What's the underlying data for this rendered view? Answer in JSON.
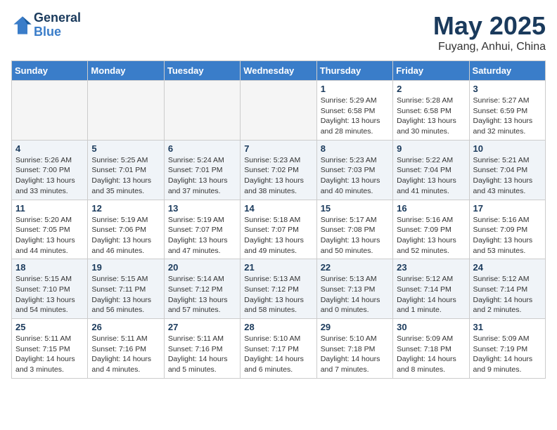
{
  "header": {
    "logo_line1": "General",
    "logo_line2": "Blue",
    "month": "May 2025",
    "location": "Fuyang, Anhui, China"
  },
  "weekdays": [
    "Sunday",
    "Monday",
    "Tuesday",
    "Wednesday",
    "Thursday",
    "Friday",
    "Saturday"
  ],
  "weeks": [
    [
      {
        "day": "",
        "info": ""
      },
      {
        "day": "",
        "info": ""
      },
      {
        "day": "",
        "info": ""
      },
      {
        "day": "",
        "info": ""
      },
      {
        "day": "1",
        "info": "Sunrise: 5:29 AM\nSunset: 6:58 PM\nDaylight: 13 hours\nand 28 minutes."
      },
      {
        "day": "2",
        "info": "Sunrise: 5:28 AM\nSunset: 6:58 PM\nDaylight: 13 hours\nand 30 minutes."
      },
      {
        "day": "3",
        "info": "Sunrise: 5:27 AM\nSunset: 6:59 PM\nDaylight: 13 hours\nand 32 minutes."
      }
    ],
    [
      {
        "day": "4",
        "info": "Sunrise: 5:26 AM\nSunset: 7:00 PM\nDaylight: 13 hours\nand 33 minutes."
      },
      {
        "day": "5",
        "info": "Sunrise: 5:25 AM\nSunset: 7:01 PM\nDaylight: 13 hours\nand 35 minutes."
      },
      {
        "day": "6",
        "info": "Sunrise: 5:24 AM\nSunset: 7:01 PM\nDaylight: 13 hours\nand 37 minutes."
      },
      {
        "day": "7",
        "info": "Sunrise: 5:23 AM\nSunset: 7:02 PM\nDaylight: 13 hours\nand 38 minutes."
      },
      {
        "day": "8",
        "info": "Sunrise: 5:23 AM\nSunset: 7:03 PM\nDaylight: 13 hours\nand 40 minutes."
      },
      {
        "day": "9",
        "info": "Sunrise: 5:22 AM\nSunset: 7:04 PM\nDaylight: 13 hours\nand 41 minutes."
      },
      {
        "day": "10",
        "info": "Sunrise: 5:21 AM\nSunset: 7:04 PM\nDaylight: 13 hours\nand 43 minutes."
      }
    ],
    [
      {
        "day": "11",
        "info": "Sunrise: 5:20 AM\nSunset: 7:05 PM\nDaylight: 13 hours\nand 44 minutes."
      },
      {
        "day": "12",
        "info": "Sunrise: 5:19 AM\nSunset: 7:06 PM\nDaylight: 13 hours\nand 46 minutes."
      },
      {
        "day": "13",
        "info": "Sunrise: 5:19 AM\nSunset: 7:07 PM\nDaylight: 13 hours\nand 47 minutes."
      },
      {
        "day": "14",
        "info": "Sunrise: 5:18 AM\nSunset: 7:07 PM\nDaylight: 13 hours\nand 49 minutes."
      },
      {
        "day": "15",
        "info": "Sunrise: 5:17 AM\nSunset: 7:08 PM\nDaylight: 13 hours\nand 50 minutes."
      },
      {
        "day": "16",
        "info": "Sunrise: 5:16 AM\nSunset: 7:09 PM\nDaylight: 13 hours\nand 52 minutes."
      },
      {
        "day": "17",
        "info": "Sunrise: 5:16 AM\nSunset: 7:09 PM\nDaylight: 13 hours\nand 53 minutes."
      }
    ],
    [
      {
        "day": "18",
        "info": "Sunrise: 5:15 AM\nSunset: 7:10 PM\nDaylight: 13 hours\nand 54 minutes."
      },
      {
        "day": "19",
        "info": "Sunrise: 5:15 AM\nSunset: 7:11 PM\nDaylight: 13 hours\nand 56 minutes."
      },
      {
        "day": "20",
        "info": "Sunrise: 5:14 AM\nSunset: 7:12 PM\nDaylight: 13 hours\nand 57 minutes."
      },
      {
        "day": "21",
        "info": "Sunrise: 5:13 AM\nSunset: 7:12 PM\nDaylight: 13 hours\nand 58 minutes."
      },
      {
        "day": "22",
        "info": "Sunrise: 5:13 AM\nSunset: 7:13 PM\nDaylight: 14 hours\nand 0 minutes."
      },
      {
        "day": "23",
        "info": "Sunrise: 5:12 AM\nSunset: 7:14 PM\nDaylight: 14 hours\nand 1 minute."
      },
      {
        "day": "24",
        "info": "Sunrise: 5:12 AM\nSunset: 7:14 PM\nDaylight: 14 hours\nand 2 minutes."
      }
    ],
    [
      {
        "day": "25",
        "info": "Sunrise: 5:11 AM\nSunset: 7:15 PM\nDaylight: 14 hours\nand 3 minutes."
      },
      {
        "day": "26",
        "info": "Sunrise: 5:11 AM\nSunset: 7:16 PM\nDaylight: 14 hours\nand 4 minutes."
      },
      {
        "day": "27",
        "info": "Sunrise: 5:11 AM\nSunset: 7:16 PM\nDaylight: 14 hours\nand 5 minutes."
      },
      {
        "day": "28",
        "info": "Sunrise: 5:10 AM\nSunset: 7:17 PM\nDaylight: 14 hours\nand 6 minutes."
      },
      {
        "day": "29",
        "info": "Sunrise: 5:10 AM\nSunset: 7:18 PM\nDaylight: 14 hours\nand 7 minutes."
      },
      {
        "day": "30",
        "info": "Sunrise: 5:09 AM\nSunset: 7:18 PM\nDaylight: 14 hours\nand 8 minutes."
      },
      {
        "day": "31",
        "info": "Sunrise: 5:09 AM\nSunset: 7:19 PM\nDaylight: 14 hours\nand 9 minutes."
      }
    ]
  ]
}
